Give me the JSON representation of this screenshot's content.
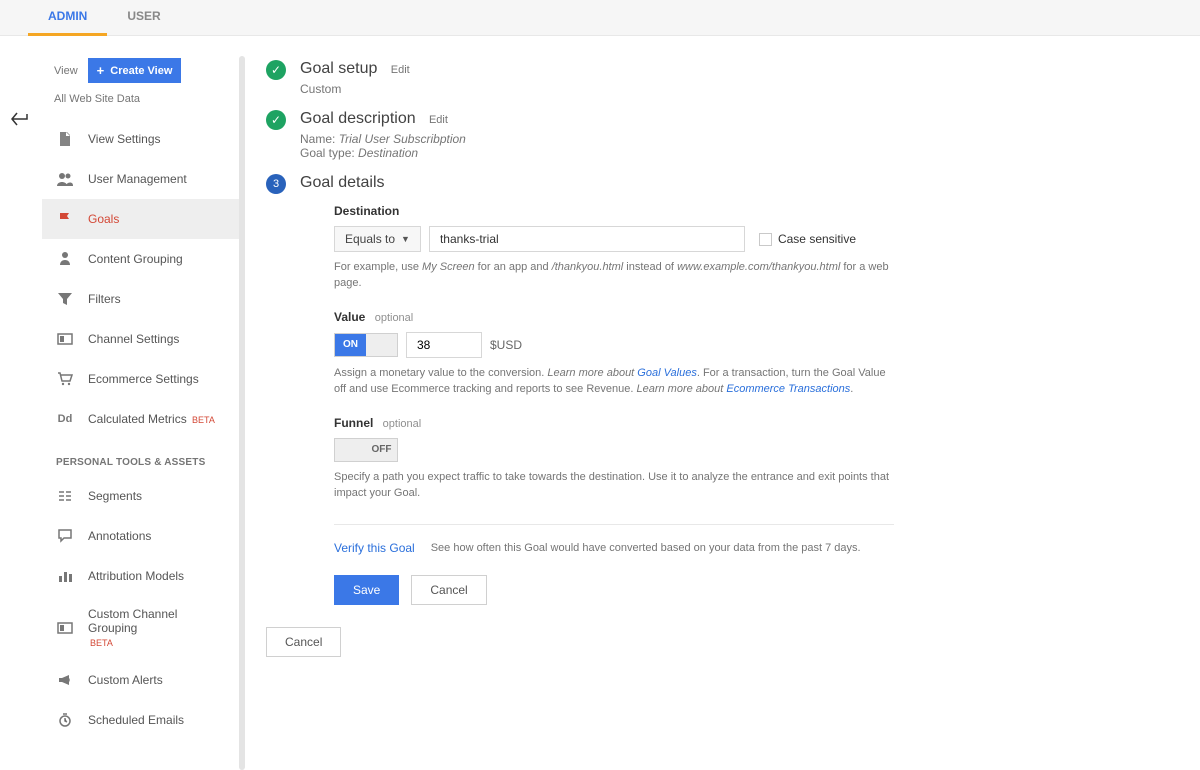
{
  "topbar": {
    "tabs": [
      "ADMIN",
      "USER"
    ]
  },
  "sidebar": {
    "view_label": "View",
    "create_view": "Create View",
    "sub_label": "All Web Site Data",
    "section_header": "PERSONAL TOOLS & ASSETS",
    "items": {
      "view_settings": "View Settings",
      "user_management": "User Management",
      "goals": "Goals",
      "content_grouping": "Content Grouping",
      "filters": "Filters",
      "channel_settings": "Channel Settings",
      "ecommerce_settings": "Ecommerce Settings",
      "calculated_metrics": "Calculated Metrics",
      "calc_beta": "BETA",
      "segments": "Segments",
      "annotations": "Annotations",
      "attribution_models": "Attribution Models",
      "custom_channel_grouping": "Custom Channel Grouping",
      "ccg_beta": "BETA",
      "custom_alerts": "Custom Alerts",
      "scheduled_emails": "Scheduled Emails"
    }
  },
  "steps": {
    "setup": {
      "title": "Goal setup",
      "edit": "Edit",
      "sub": "Custom"
    },
    "description": {
      "title": "Goal description",
      "edit": "Edit",
      "name_label": "Name: ",
      "name_value": "Trial User Subscribption",
      "type_label": "Goal type: ",
      "type_value": "Destination"
    },
    "details": {
      "num": "3",
      "title": "Goal details",
      "destination": {
        "label": "Destination",
        "match": "Equals to",
        "value": "thanks-trial",
        "case_sensitive": "Case sensitive",
        "help_pre": "For example, use ",
        "help_ex1": "My Screen",
        "help_mid1": " for an app and ",
        "help_ex2": "/thankyou.html",
        "help_mid2": " instead of ",
        "help_ex3": "www.example.com/thankyou.html",
        "help_post": " for a web page."
      },
      "value": {
        "label": "Value",
        "optional": "optional",
        "on": "ON",
        "input": "38",
        "currency": "$USD",
        "help1": "Assign a monetary value to the conversion. ",
        "link1_pre": "Learn more about ",
        "link1": "Goal Values",
        "help2": ". For a transaction, turn the Goal Value off and use Ecommerce tracking and reports to see Revenue. ",
        "link2_pre": "Learn more about ",
        "link2": "Ecommerce Transactions",
        "help2_post": "."
      },
      "funnel": {
        "label": "Funnel",
        "optional": "optional",
        "off": "OFF",
        "help": "Specify a path you expect traffic to take towards the destination. Use it to analyze the entrance and exit points that impact your Goal."
      },
      "verify": {
        "link": "Verify this Goal",
        "desc": "See how often this Goal would have converted based on your data from the past 7 days."
      },
      "buttons": {
        "save": "Save",
        "cancel": "Cancel"
      }
    },
    "outer_cancel": "Cancel"
  }
}
